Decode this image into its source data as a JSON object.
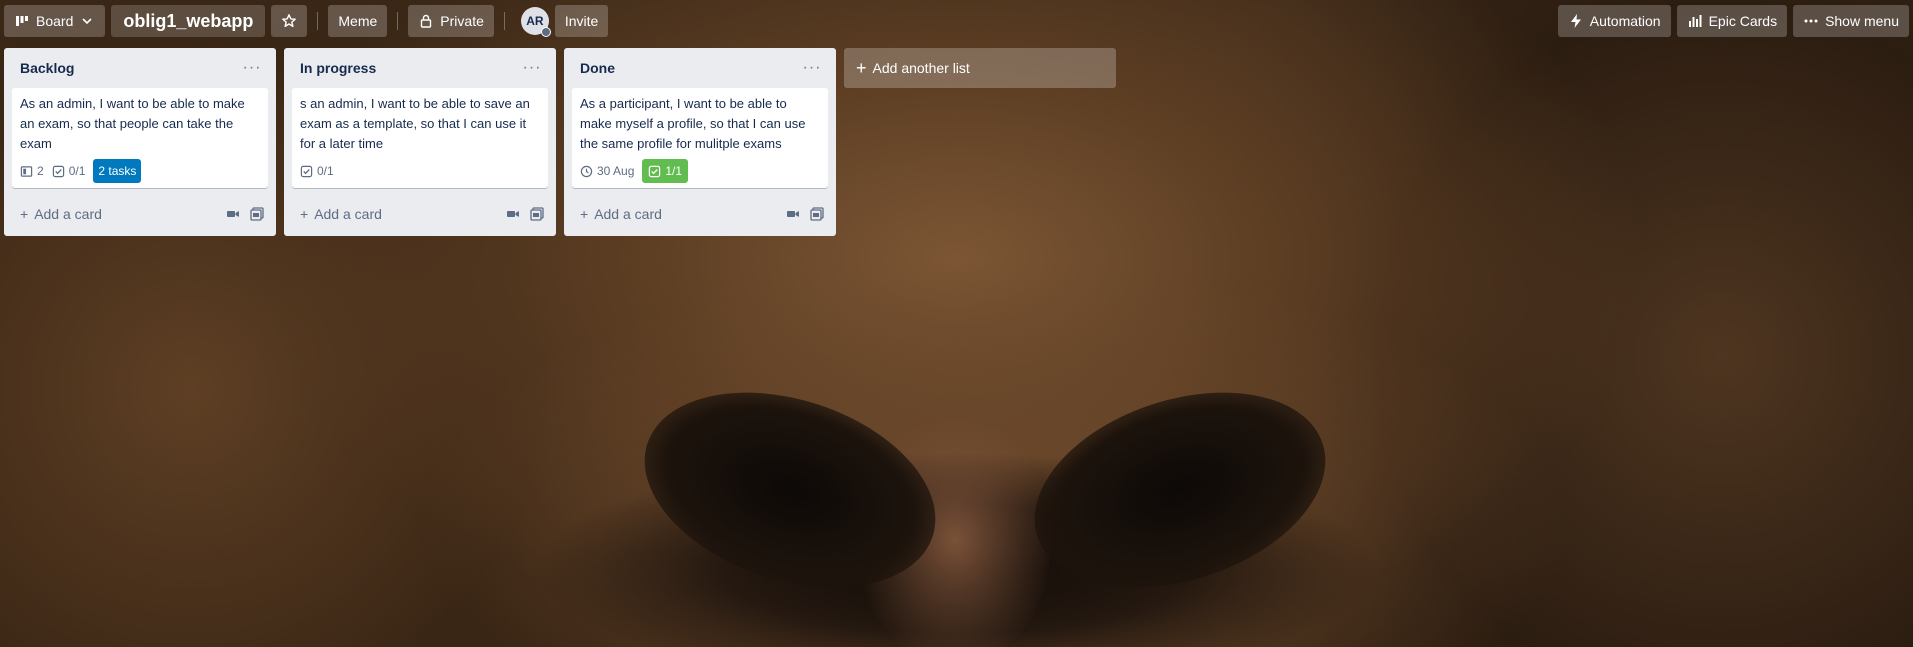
{
  "header": {
    "view_label": "Board",
    "board_title": "oblig1_webapp",
    "workspace_label": "Meme",
    "visibility_label": "Private",
    "avatar_initials": "AR",
    "invite_label": "Invite",
    "automation_label": "Automation",
    "epic_cards_label": "Epic Cards",
    "show_menu_label": "Show menu"
  },
  "lists": [
    {
      "title": "Backlog",
      "card": {
        "text": "As an admin, I want to be able to make an exam, so that people can take the exam",
        "attachments_count": "2",
        "checklist": "0/1",
        "tasks_label": "2 tasks"
      },
      "add_card_label": "Add a card"
    },
    {
      "title": "In progress",
      "card": {
        "text": "s an admin, I want to be able to save an exam as a template, so that I can use it for a later time",
        "checklist": "0/1"
      },
      "add_card_label": "Add a card"
    },
    {
      "title": "Done",
      "card": {
        "text": "As a participant, I want to be able to make myself a profile, so that I can use the same profile for mulitple exams",
        "due_date": "30 Aug",
        "checklist": "1/1"
      },
      "add_card_label": "Add a card"
    }
  ],
  "add_list_label": "Add another list",
  "colors": {
    "list_bg": "#ebecf0",
    "tasks_label_bg": "#0079bf",
    "checklist_done_bg": "#61bd4f"
  }
}
